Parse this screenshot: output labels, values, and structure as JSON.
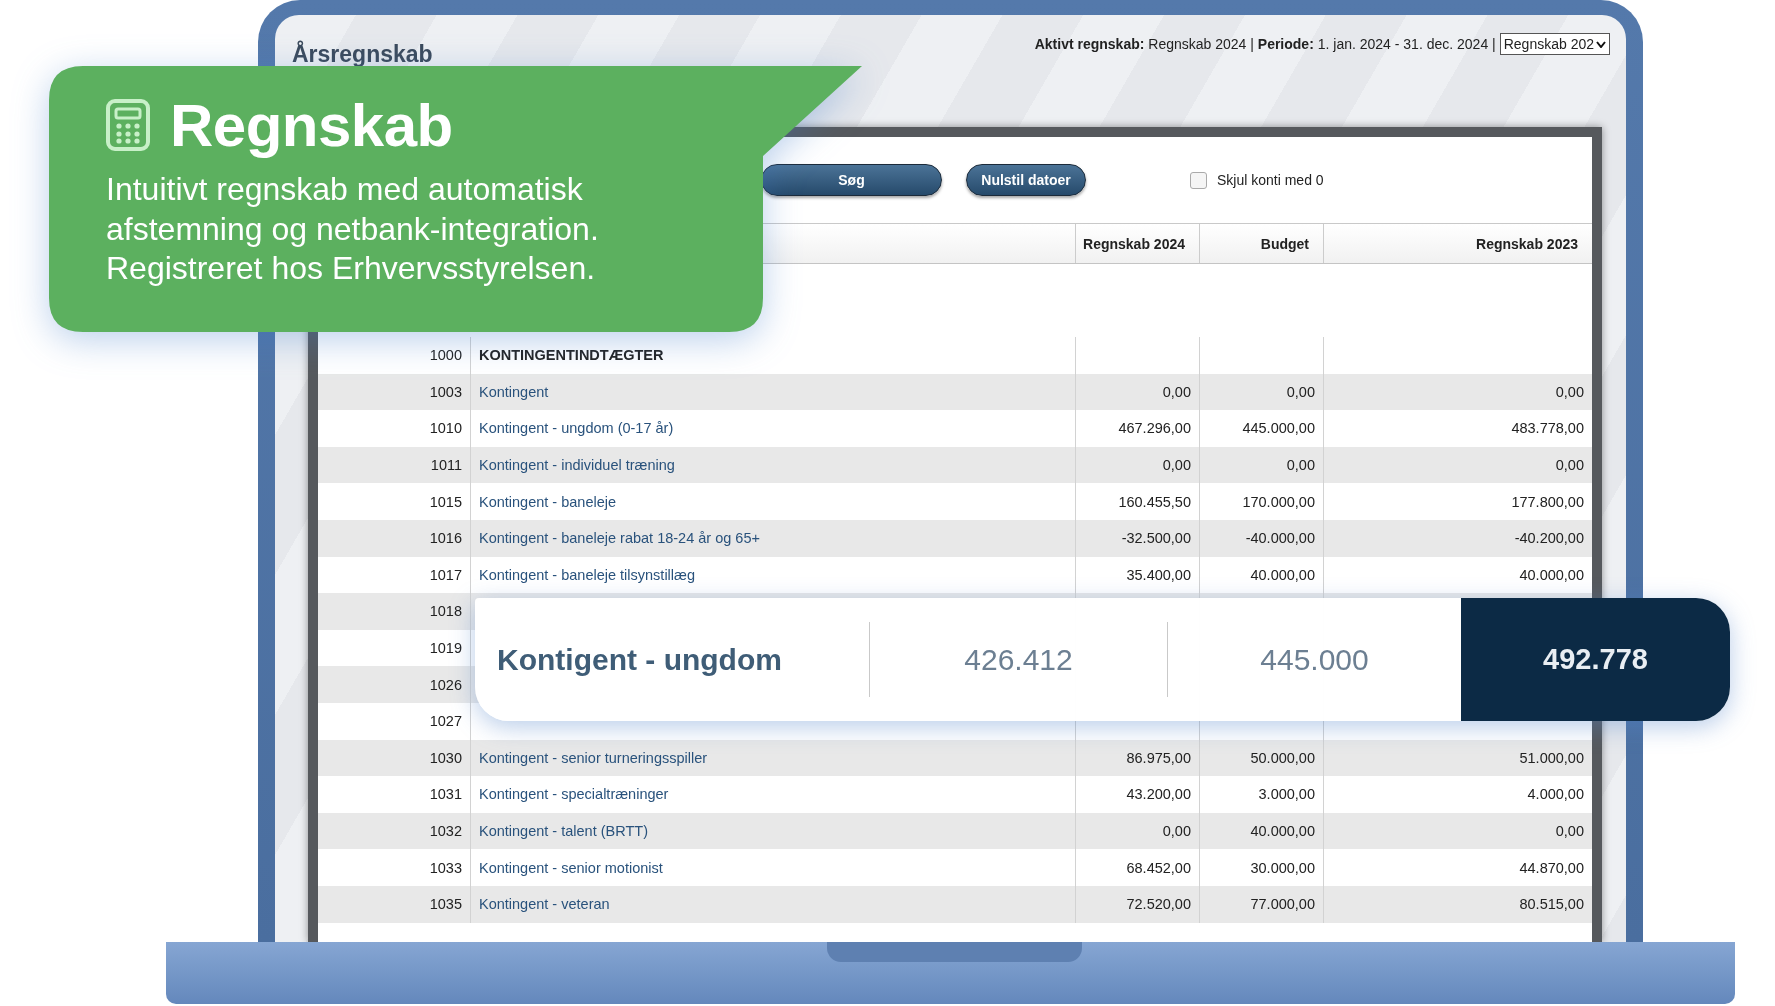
{
  "screen": {
    "title": "Årsregnskab",
    "info": "**Aktivt regnskab:** Regnskab 2024  |  **Periode:** 1. jan. 2024 - 31. dec. 2024 |",
    "year_select": "Regnskab 202",
    "search_button": "Søg",
    "reset_button": "Nulstil datoer",
    "hide_zero": {
      "label": "Skjul konti med 0",
      "checked": false
    },
    "table": {
      "columns": [
        "Regnskab 2024",
        "Budget",
        "Regnskab 2023"
      ],
      "rows": [
        {
          "kind": "group",
          "number": "1000",
          "name": "KONTINGENTINDTÆGTER"
        },
        {
          "kind": "account",
          "number": "1003",
          "name": "Kontingent",
          "values": [
            "0,00",
            "0,00",
            "0,00"
          ]
        },
        {
          "kind": "account",
          "number": "1010",
          "name": "Kontingent - ungdom (0-17 år)",
          "values": [
            "467.296,00",
            "445.000,00",
            "483.778,00"
          ]
        },
        {
          "kind": "account",
          "number": "1011",
          "name": "Kontingent - individuel træning",
          "values": [
            "0,00",
            "0,00",
            "0,00"
          ]
        },
        {
          "kind": "account",
          "number": "1015",
          "name": "Kontingent - baneleje",
          "values": [
            "160.455,50",
            "170.000,00",
            "177.800,00"
          ]
        },
        {
          "kind": "account",
          "number": "1016",
          "name": "Kontingent - baneleje rabat 18-24 år og 65+",
          "values": [
            "-32.500,00",
            "-40.000,00",
            "-40.200,00"
          ]
        },
        {
          "kind": "account",
          "number": "1017",
          "name": "Kontingent - baneleje tilsynstillæg",
          "values": [
            "35.400,00",
            "40.000,00",
            "40.000,00"
          ]
        },
        {
          "kind": "covered",
          "number": "1018"
        },
        {
          "kind": "covered",
          "number": "1019"
        },
        {
          "kind": "covered",
          "number": "1026"
        },
        {
          "kind": "covered",
          "number": "1027"
        },
        {
          "kind": "account",
          "number": "1030",
          "name": "Kontingent - senior turneringsspiller",
          "values": [
            "86.975,00",
            "50.000,00",
            "51.000,00"
          ]
        },
        {
          "kind": "account",
          "number": "1031",
          "name": "Kontingent - specialtræninger",
          "values": [
            "43.200,00",
            "3.000,00",
            "4.000,00"
          ]
        },
        {
          "kind": "account",
          "number": "1032",
          "name": "Kontingent - talent (BRTT)",
          "values": [
            "0,00",
            "40.000,00",
            "0,00"
          ]
        },
        {
          "kind": "account",
          "number": "1033",
          "name": "Kontingent - senior motionist",
          "values": [
            "68.452,00",
            "30.000,00",
            "44.870,00"
          ]
        },
        {
          "kind": "account",
          "number": "1035",
          "name": "Kontingent - veteran",
          "values": [
            "72.520,00",
            "77.000,00",
            "80.515,00"
          ]
        }
      ]
    }
  },
  "promo": {
    "title": "Regnskab",
    "lines": [
      "Intuitivt regnskab med automatisk",
      "afstemning og netbank-integration.",
      "Registreret hos Erhvervsstyrelsen."
    ]
  },
  "highlight": {
    "name": "Kontigent - ungdom",
    "values": [
      "426.412",
      "445.000"
    ],
    "total": "492.778"
  }
}
